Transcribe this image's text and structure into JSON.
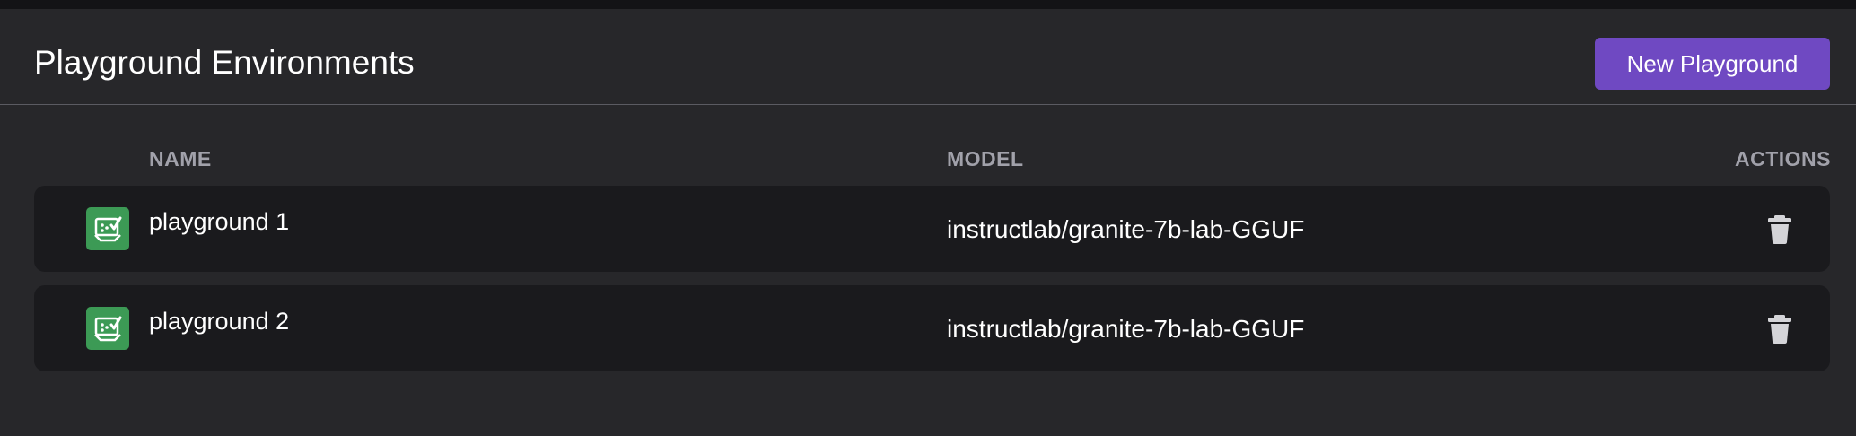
{
  "header": {
    "title": "Playground Environments",
    "new_button_label": "New Playground"
  },
  "table": {
    "columns": [
      "NAME",
      "MODEL",
      "ACTIONS"
    ],
    "rows": [
      {
        "name": "playground 1",
        "model": "instructlab/granite-7b-lab-GGUF",
        "icon": "playground-icon",
        "action_icon": "trash-icon"
      },
      {
        "name": "playground 2",
        "model": "instructlab/granite-7b-lab-GGUF",
        "icon": "playground-icon",
        "action_icon": "trash-icon"
      }
    ]
  },
  "colors": {
    "background": "#27272a",
    "row_background": "#1a1a1d",
    "accent_button": "#6f49c2",
    "icon_green": "#3c9a55",
    "header_text": "#a1a1aa"
  }
}
